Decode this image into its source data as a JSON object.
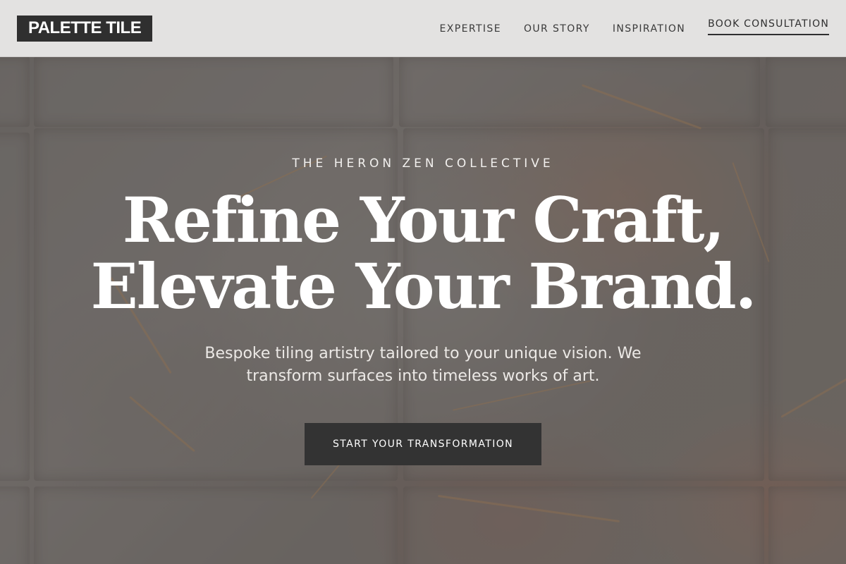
{
  "header": {
    "logo_text": "PALETTE TILE",
    "nav": [
      {
        "label": "EXPERTISE"
      },
      {
        "label": "OUR STORY"
      },
      {
        "label": "INSPIRATION"
      }
    ],
    "cta_label": "BOOK CONSULTATION"
  },
  "hero": {
    "eyebrow": "THE HERON ZEN COLLECTIVE",
    "headline_line1": "Refine Your Craft,",
    "headline_line2": "Elevate Your Brand.",
    "subtext": "Bespoke tiling artistry tailored to your unique vision. We transform surfaces into timeless works of art.",
    "button_label": "START YOUR TRANSFORMATION",
    "background": "marble-tile-photo"
  },
  "colors": {
    "header_bg": "#e3e2e1",
    "logo_bg": "#2f2f2f",
    "button_bg": "#333333",
    "text_light": "#ffffff"
  }
}
